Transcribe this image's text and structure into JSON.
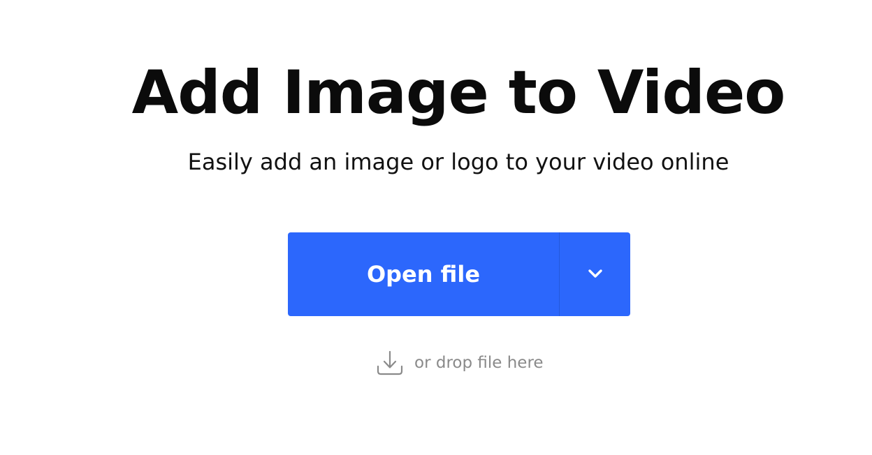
{
  "hero": {
    "title": "Add Image to Video",
    "subtitle": "Easily add an image or logo to your video online"
  },
  "upload": {
    "open_label": "Open file",
    "dropdown_icon": "chevron-down-icon",
    "drop_hint": "or drop file here",
    "drop_icon": "download-icon"
  },
  "colors": {
    "accent": "#2c67fc",
    "hint_text": "#8a8a8a",
    "title_text": "#0b0b0b"
  }
}
